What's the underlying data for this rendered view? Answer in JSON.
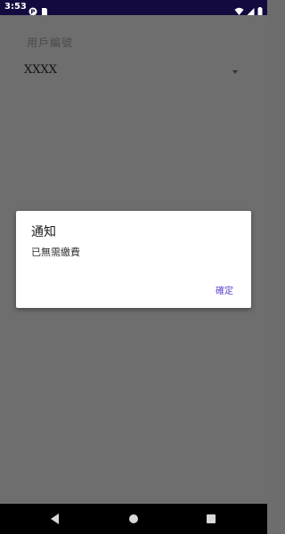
{
  "status_bar": {
    "time": "3:53",
    "icons": [
      "app-notification-icon",
      "sim-card-icon",
      "wifi-icon",
      "signal-icon",
      "battery-icon"
    ]
  },
  "form": {
    "user_id_label": "用戶編號",
    "user_id_value": "XXXX"
  },
  "dialog": {
    "title": "通知",
    "message": "已無需繳費",
    "ok_label": "確定"
  },
  "navigation": {
    "icons": [
      "back-icon",
      "home-icon",
      "recents-icon"
    ]
  },
  "colors": {
    "status_bar": "#130b3f",
    "scrim_background": "#6e6e6e",
    "dialog_button": "#5e3fcc"
  }
}
